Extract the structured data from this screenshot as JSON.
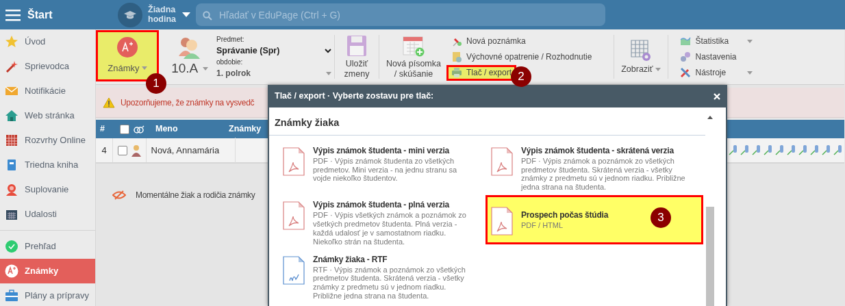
{
  "topbar": {
    "menu_label": "Štart",
    "lesson": "Žiadna hodina",
    "search": {
      "placeholder": "Hľadať v EduPage (Ctrl + G)"
    }
  },
  "sidebar": {
    "groups": [
      [
        {
          "label": "Úvod",
          "selected": false
        },
        {
          "label": "Sprievodca",
          "selected": false
        },
        {
          "label": "Notifikácie",
          "selected": false
        },
        {
          "label": "Web stránka",
          "selected": false
        },
        {
          "label": "Rozvrhy Online",
          "selected": false
        },
        {
          "label": "Triedna kniha",
          "selected": false
        },
        {
          "label": "Suplovanie",
          "selected": false
        },
        {
          "label": "Udalosti",
          "selected": false
        }
      ],
      [
        {
          "label": "Prehľad",
          "selected": false
        },
        {
          "label": "Známky",
          "selected": true
        },
        {
          "label": "Plány a prípravy",
          "selected": false
        }
      ]
    ]
  },
  "toolbar": {
    "grades_button": {
      "label": "Známky",
      "highlighted": true
    },
    "class_name": "10.A",
    "subject_label": "Predmet:",
    "subject": "Správanie (Spr)",
    "period_label": "obdobie:",
    "period": "1. polrok",
    "save": "Uložiť zmeny",
    "new_test": "Nová písomka / skúšanie",
    "actions": [
      {
        "label": "Nová poznámka",
        "highlighted": false
      },
      {
        "label": "Výchovné opatrenie / Rozhodnutie",
        "highlighted": false
      },
      {
        "label": "Tlač / export",
        "highlighted": true
      }
    ],
    "display": "Zobraziť",
    "tools": [
      {
        "label": "Štatistika",
        "dropdown": true
      },
      {
        "label": "Nastavenia",
        "dropdown": false
      },
      {
        "label": "Nástroje",
        "dropdown": true
      }
    ]
  },
  "alert": "Upozorňujeme, že známky na vysvedč",
  "table": {
    "header_checked": false,
    "columns": [
      "#",
      "Meno",
      "Známky"
    ],
    "rows": [
      {
        "number": "4",
        "checked": false,
        "name": "Nová, Annamária"
      }
    ]
  },
  "info": "Momentálne žiak a rodičia známky",
  "modal": {
    "title": "Tlač / export · Vyberte zostavu pre tlač:",
    "section": "Známky žiaka",
    "reports": [
      {
        "kind": "pdf",
        "title": "Výpis známok študenta - mini verzia",
        "description": "PDF · Výpis známok študenta zo všetkých predmetov. Mini verzia - na jednu stranu sa vojde niekoľko študentov.",
        "highlighted": false
      },
      {
        "kind": "pdf",
        "title": "Výpis známok študenta - skrátená verzia",
        "description": "PDF · Výpis známok a poznámok zo všetkých predmetov študenta. Skrátená verzia - všetky známky z predmetu sú v jednom riadku. Približne jedna strana na študenta.",
        "highlighted": false
      },
      {
        "kind": "pdf",
        "title": "Výpis známok študenta - plná verzia",
        "description": "PDF · Výpis všetkých známok a poznámok zo všetkých predmetov študenta. Plná verzia - každá udalosť je v samostatnom riadku. Niekoľko strán na študenta.",
        "highlighted": false
      },
      {
        "kind": "pdf",
        "title": "Prospech počas štúdia",
        "description": "PDF / HTML",
        "highlighted": true
      },
      {
        "kind": "rtf",
        "title": "Známky žiaka - RTF",
        "description": "RTF · Výpis známok a poznámok zo všetkých predmetov študenta. Skrátená verzia - všetky známky z predmetu sú v jednom riadku. Približne jedna strana na študenta.",
        "highlighted": false
      }
    ]
  },
  "annotations": [
    {
      "label": "1"
    },
    {
      "label": "2"
    },
    {
      "label": "3"
    }
  ]
}
